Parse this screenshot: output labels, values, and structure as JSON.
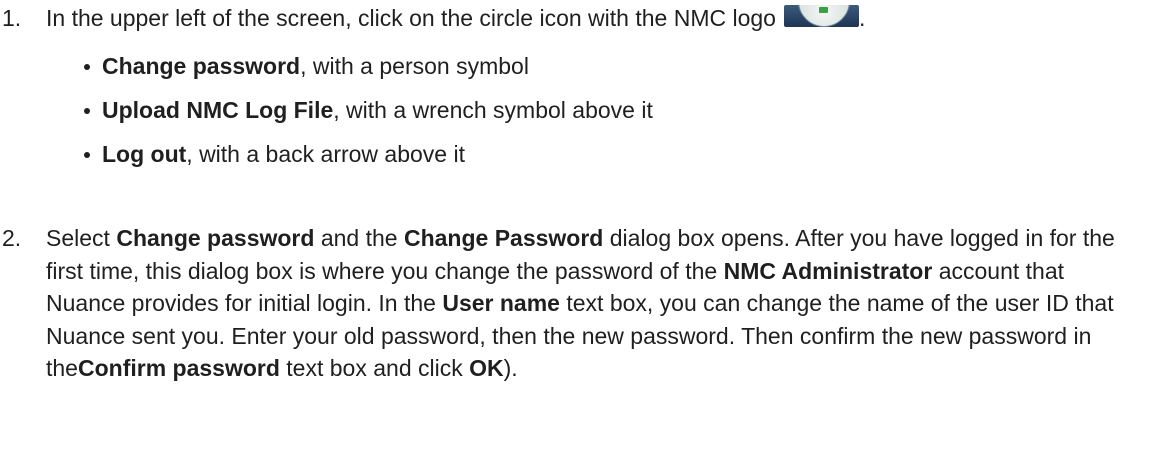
{
  "step1": {
    "number": "1.",
    "text": "In the upper left of the screen, click on the circle icon with the NMC logo",
    "period": ".",
    "logo_icon": "nmc-logo-icon",
    "bullets": [
      {
        "bold": "Change password",
        "rest": ", with a person symbol"
      },
      {
        "bold": "Upload NMC Log File",
        "rest": ", with a wrench symbol above it"
      },
      {
        "bold": "Log out",
        "rest": ", with a back arrow above it"
      }
    ]
  },
  "step2": {
    "number": "2.",
    "segments": [
      {
        "t": "Select ",
        "b": false
      },
      {
        "t": "Change password",
        "b": true
      },
      {
        "t": " and the ",
        "b": false
      },
      {
        "t": "Change Password",
        "b": true
      },
      {
        "t": " dialog box opens. After you have logged in for the first time, this dialog box is where you change the password of the ",
        "b": false
      },
      {
        "t": "NMC Administrator",
        "b": true
      },
      {
        "t": " account that Nuance provides for initial login. In the ",
        "b": false
      },
      {
        "t": "User name",
        "b": true
      },
      {
        "t": " text box, you can change the name of the user ID that Nuance sent you. Enter your old password, then the new password. Then confirm the new password in the",
        "b": false
      },
      {
        "t": "Confirm password",
        "b": true
      },
      {
        "t": " text box and click ",
        "b": false
      },
      {
        "t": "OK",
        "b": true
      },
      {
        "t": ").",
        "b": false
      }
    ]
  }
}
